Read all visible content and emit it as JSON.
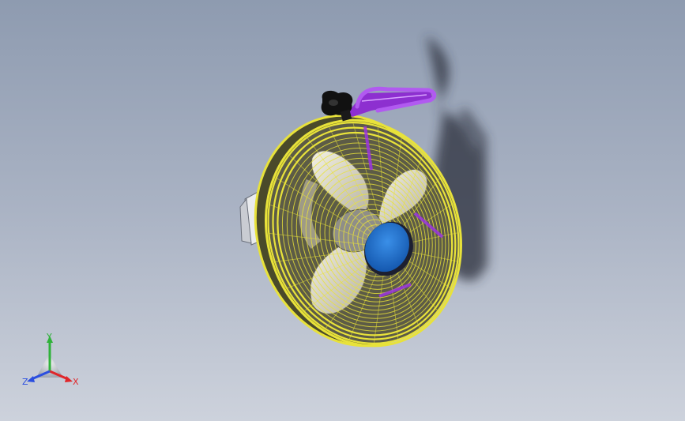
{
  "viewport": {
    "colors": {
      "background_top": "#8e9bb0",
      "background_bottom": "#cdd2dc",
      "grille": "#e8e23a",
      "grille_dark": "#3a3a1c",
      "hub": "#1e6fc8",
      "handle": "#9b35e0",
      "knob": "#111111",
      "shadow": "#2a2f3a"
    },
    "model": {
      "parts": [
        "fan-guard-grille",
        "fan-blade",
        "hub-cap",
        "carry-handle",
        "tilt-knob",
        "motor-housing",
        "mounting-bracket"
      ]
    }
  },
  "triad": {
    "x_label": "X",
    "y_label": "Y",
    "z_label": "Z",
    "colors": {
      "x": "#e0262a",
      "y": "#2fb23a",
      "z": "#2a4ee0"
    }
  }
}
